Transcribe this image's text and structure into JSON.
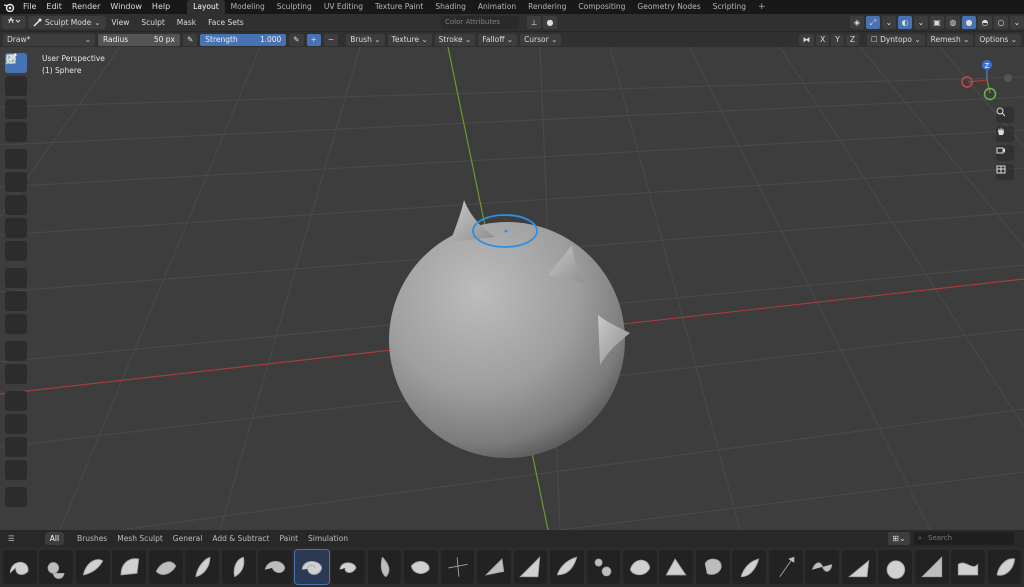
{
  "top_menu": [
    "File",
    "Edit",
    "Render",
    "Window",
    "Help"
  ],
  "workspaces": [
    "Layout",
    "Modeling",
    "Sculpting",
    "UV Editing",
    "Texture Paint",
    "Shading",
    "Animation",
    "Rendering",
    "Compositing",
    "Geometry Nodes",
    "Scripting"
  ],
  "active_workspace": "Layout",
  "header": {
    "mode": "Sculpt Mode",
    "menus": [
      "View",
      "Sculpt",
      "Mask",
      "Face Sets"
    ],
    "color_attributes": "Color Attributes"
  },
  "tool_settings": {
    "brush_name": "Draw*",
    "radius_label": "Radius",
    "radius_value": "50 px",
    "strength_label": "Strength",
    "strength_value": "1.000",
    "menus": [
      "Brush",
      "Texture",
      "Stroke",
      "Falloff",
      "Cursor"
    ],
    "axes": [
      "X",
      "Y",
      "Z"
    ],
    "dyntopo": "Dyntopo",
    "remesh": "Remesh",
    "options": "Options"
  },
  "viewport": {
    "view_name": "User Perspective",
    "object_name": "(1) Sphere"
  },
  "toolbar_icons": [
    "draw-brush-icon",
    "draw-sharp-icon",
    "clay-icon",
    "paint-icon",
    "mask-icon",
    "box-mask-icon",
    "face-set-icon",
    "box-face-set-icon",
    "trim-icon",
    "line-project-icon",
    "mesh-filter-icon",
    "cloth-filter-icon",
    "color-filter-icon",
    "edit-face-set-icon",
    "mask-by-color-icon",
    "move-icon",
    "rotate-icon",
    "scale-icon",
    "transform-icon",
    "annotate-icon"
  ],
  "gizmo": {
    "z_label": "Z"
  },
  "shelf": {
    "tabs": [
      "All",
      "Brushes",
      "Mesh Sculpt",
      "General",
      "Add & Subtract",
      "Paint",
      "Simulation"
    ],
    "active_tab": "All",
    "search_placeholder": "Search",
    "brush_count": 28,
    "active_brush_index": 8
  },
  "colors": {
    "accent": "#4772b3",
    "x_axis": "#a83c3c",
    "y_axis": "#6a9b2a",
    "brush_circle": "#2f8fe0"
  }
}
